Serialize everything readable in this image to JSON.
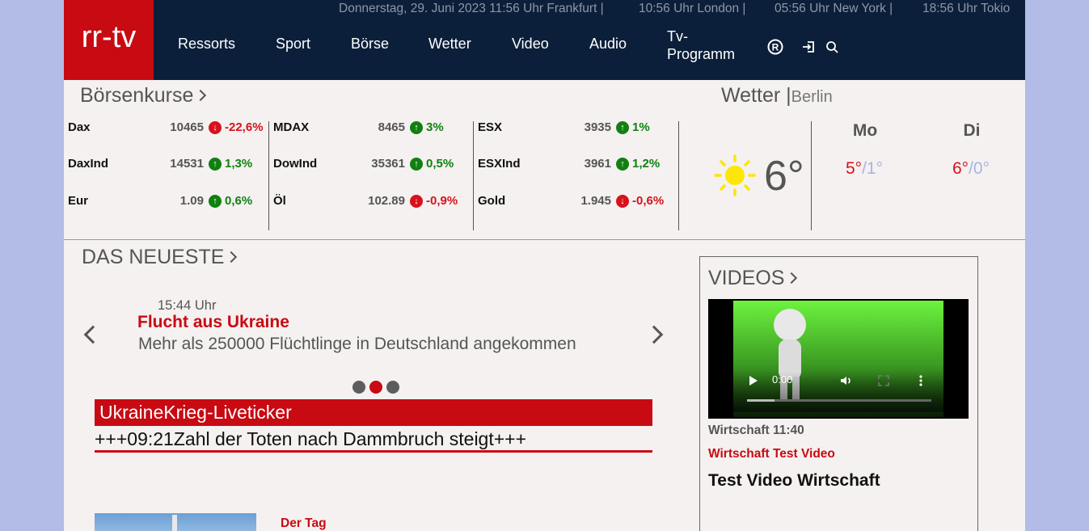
{
  "header": {
    "logo": "rr-tv",
    "times": [
      "Donnerstag, 29. Juni 2023 11:56 Uhr Frankfurt |",
      "10:56 Uhr London |",
      "05:56 Uhr New York |",
      "18:56 Uhr Tokio"
    ],
    "nav": [
      "Ressorts",
      "Sport",
      "Börse",
      "Wetter",
      "Video",
      "Audio"
    ],
    "nav_tv_line1": "Tv-",
    "nav_tv_line2": "Programm",
    "icons": [
      "registered-icon",
      "login-icon",
      "search-icon"
    ]
  },
  "boerse": {
    "title": "Börsenkurse",
    "columns": [
      [
        {
          "name": "Dax",
          "value": "10465",
          "dir": "down",
          "change": "-22,6%"
        },
        {
          "name": "DaxInd",
          "value": "14531",
          "dir": "up",
          "change": "1,3%"
        },
        {
          "name": "Eur",
          "value": "1.09",
          "dir": "up",
          "change": "0,6%"
        }
      ],
      [
        {
          "name": "MDAX",
          "value": "8465",
          "dir": "up",
          "change": "3%"
        },
        {
          "name": "DowInd",
          "value": "35361",
          "dir": "up",
          "change": "0,5%"
        },
        {
          "name": "Öl",
          "value": "102.89",
          "dir": "down",
          "change": "-0,9%"
        }
      ],
      [
        {
          "name": "ESX",
          "value": "3935",
          "dir": "up",
          "change": "1%"
        },
        {
          "name": "ESXInd",
          "value": "3961",
          "dir": "up",
          "change": "1,2%"
        },
        {
          "name": "Gold",
          "value": "1.945",
          "dir": "down",
          "change": "-0,6%"
        }
      ]
    ],
    "colors": {
      "up": "#118011",
      "down": "#d7121b"
    }
  },
  "weather": {
    "title": "Wetter |",
    "city": "Berlin",
    "current_temp": "6°",
    "icon": "sun-icon",
    "forecast": [
      {
        "day": "Mo",
        "high": "5°",
        "low": "/1°"
      },
      {
        "day": "Di",
        "high": "6°",
        "low": "/0°"
      }
    ]
  },
  "news": {
    "title": "DAS NEUESTE",
    "time": "15:44 Uhr",
    "headline": "Flucht aus Ukraine",
    "teaser": "Mehr als 250000 Flüchtlinge in Deutschland angekommen",
    "active_dot": 1,
    "dot_count": 3,
    "ticker_title": "UkraineKrieg-Liveticker",
    "ticker_text": "+++09:21Zahl der Toten nach Dammbruch steigt+++",
    "next_label": "Der Tag"
  },
  "videos": {
    "title": "VIDEOS",
    "player_time": "0:00",
    "meta": "Wirtschaft 11:40",
    "kicker": "Wirtschaft Test Video",
    "headline": "Test Video Wirtschaft"
  },
  "brand_red": "#c80a12",
  "header_bg": "#0c1f3a"
}
